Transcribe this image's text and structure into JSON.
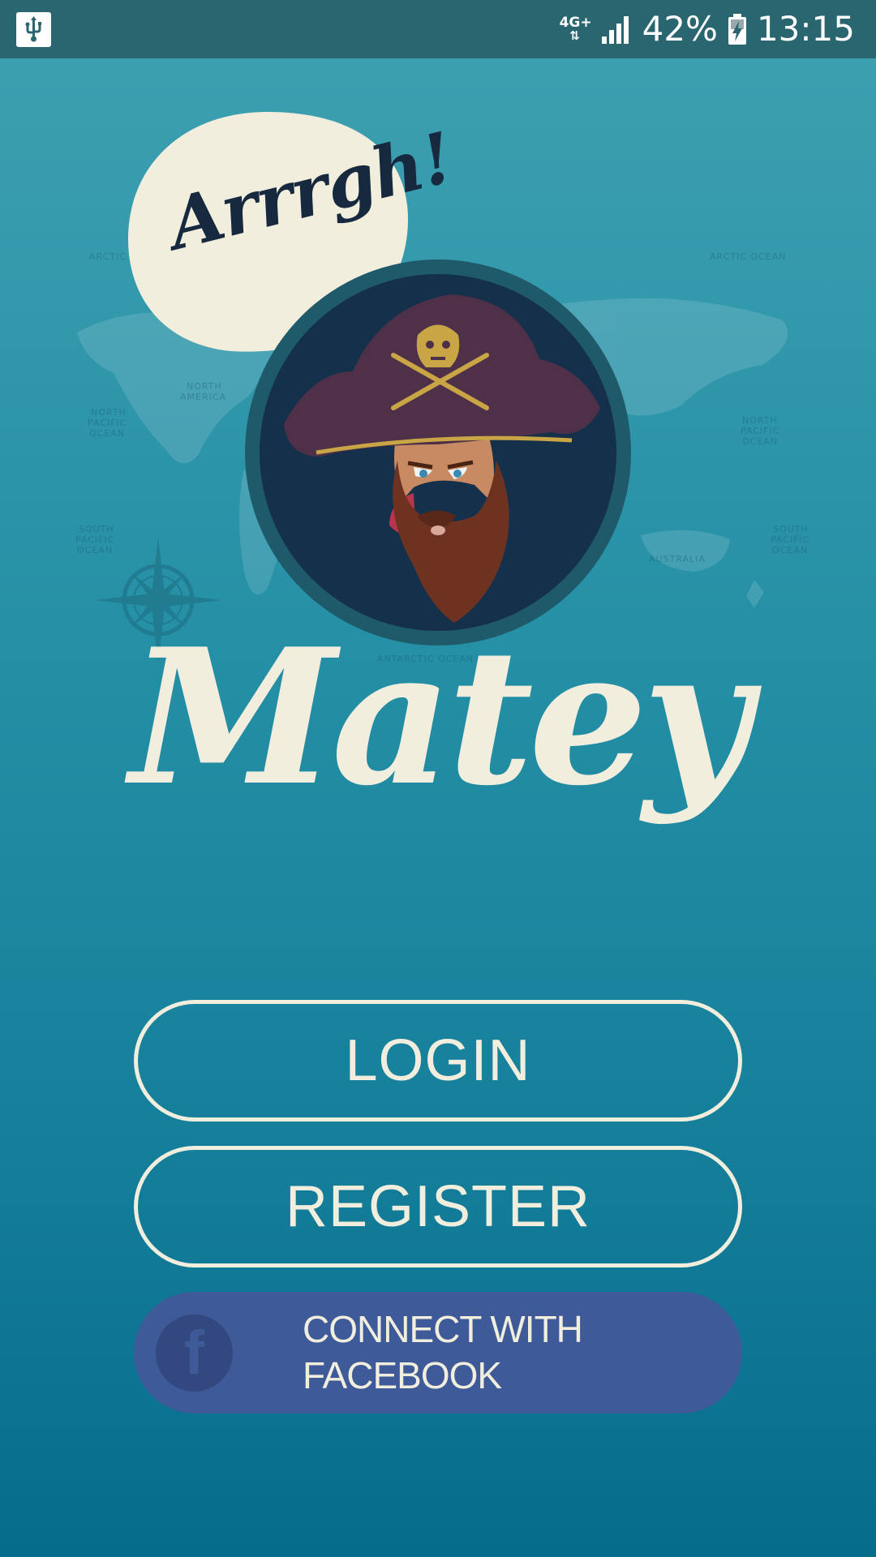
{
  "status_bar": {
    "network": "4G+",
    "network_arrows": "⇅",
    "battery_percent": "42%",
    "time": "13:15",
    "icons": [
      "usb-icon",
      "network-4g-icon",
      "signal-icon",
      "battery-charging-icon"
    ]
  },
  "hero": {
    "speech_bubble_text": "Arrrgh!",
    "logo_icon": "pirate-captain-icon",
    "app_title": "Matey"
  },
  "actions": {
    "login_label": "LOGIN",
    "register_label": "REGISTER",
    "facebook_label": "CONNECT WITH FACEBOOK",
    "facebook_icon": "f"
  },
  "colors": {
    "background_top": "#3fa1b1",
    "background_bottom": "#066c8c",
    "status_bar": "#2a6670",
    "cream": "#f1eede",
    "facebook_blue": "#3e5a99",
    "navy": "#17293e"
  }
}
